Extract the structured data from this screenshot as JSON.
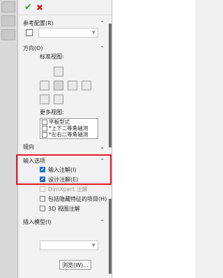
{
  "toolbar": {
    "ok_icon": "✔",
    "cancel_icon": "✖"
  },
  "sections": {
    "reference_config": {
      "label": "参考配置(R)"
    },
    "orientation": {
      "label": "方向(O)",
      "standard_views": "标准视图:",
      "more_views": "更多视图:"
    },
    "more_views_list": [
      {
        "label": "平板型式",
        "checked": false
      },
      {
        "label": "*上下二等角轴测",
        "checked": false
      },
      {
        "label": "*左右二等角轴测",
        "checked": false
      }
    ],
    "mirror": {
      "label": "镜向"
    },
    "input_options": {
      "label": "输入选项",
      "items": [
        {
          "label": "输入注解(I)",
          "checked": true,
          "disabled": false
        },
        {
          "label": "设计注解(E)",
          "checked": true,
          "disabled": false
        },
        {
          "label": "DimXpert 注解",
          "checked": false,
          "disabled": true
        },
        {
          "label": "包括隐藏特征的项目(H)",
          "checked": false,
          "disabled": false
        },
        {
          "label": "3D 视图注解",
          "checked": false,
          "disabled": false
        }
      ]
    },
    "insert_model": {
      "label": "插入模型(I)",
      "browse_label": "浏览(W)..."
    }
  }
}
